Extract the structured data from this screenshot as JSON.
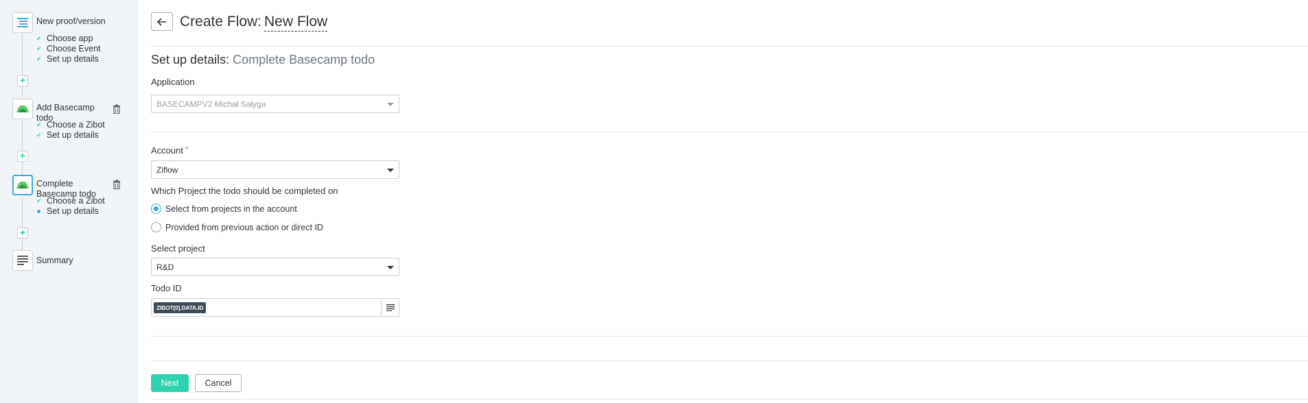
{
  "header": {
    "title": "Create Flow:",
    "flow_name": "New Flow"
  },
  "sidebar": {
    "steps": [
      {
        "title": "New proof/version",
        "icon": "list-icon",
        "substeps": [
          {
            "label": "Choose app",
            "status": "done"
          },
          {
            "label": "Choose Event",
            "status": "done"
          },
          {
            "label": "Set up details",
            "status": "done"
          }
        ]
      },
      {
        "title": "Add Basecamp todo",
        "icon": "basecamp-icon",
        "substeps": [
          {
            "label": "Choose a Zibot",
            "status": "done"
          },
          {
            "label": "Set up details",
            "status": "done"
          }
        ]
      },
      {
        "title": "Complete Basecamp todo",
        "icon": "basecamp-icon",
        "active": true,
        "substeps": [
          {
            "label": "Choose a Zibot",
            "status": "done"
          },
          {
            "label": "Set up details",
            "status": "current"
          }
        ]
      },
      {
        "title": "Summary",
        "icon": "summary-icon",
        "substeps": []
      }
    ]
  },
  "form": {
    "section_title": "Set up details:",
    "section_subtitle": "Complete Basecamp todo",
    "application_label": "Application",
    "application_value": "BASECAMPV2 Michał Sałyga",
    "account_label": "Account",
    "account_required": "*",
    "account_value": "Ziflow",
    "project_question": "Which Project the todo should be completed on",
    "radio_options": [
      {
        "label": "Select from projects in the account",
        "selected": true
      },
      {
        "label": "Provided from previous action or direct ID",
        "selected": false
      }
    ],
    "select_project_label": "Select project",
    "select_project_value": "R&D",
    "todo_id_label": "Todo ID",
    "todo_id_token": "ZIBOT[0].DATA.ID"
  },
  "buttons": {
    "next": "Next",
    "cancel": "Cancel"
  },
  "colors": {
    "accent_green": "#2fd3b0",
    "check_green": "#2dcc9f",
    "active_blue": "#3aa7d9",
    "sidebar_bg": "#f1f4f7"
  }
}
